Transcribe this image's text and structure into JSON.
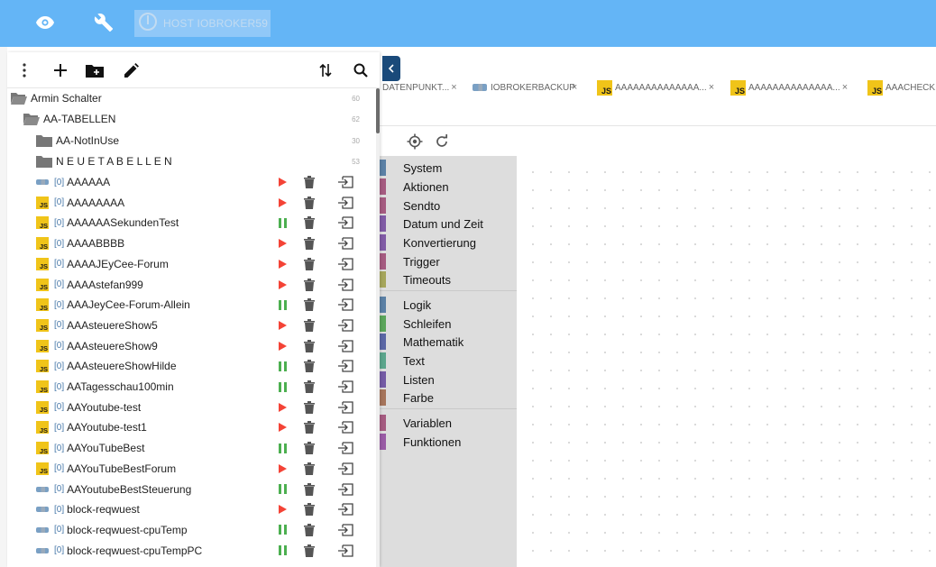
{
  "topbar": {
    "host_label": "HOST IOBROKER59",
    "icons": [
      "eye-icon",
      "wrench-icon",
      "power-icon"
    ]
  },
  "left_panel": {
    "toolbar_icons": [
      "more-vert-icon",
      "add-icon",
      "add-folder-icon",
      "edit-icon",
      "sort-icon",
      "search-icon"
    ],
    "tree": {
      "root": {
        "label": "Armin Schalter",
        "count": "60"
      },
      "folders": [
        {
          "label": "AA-TABELLEN",
          "count": "62"
        },
        {
          "label": "AA-NotInUse",
          "count": "30"
        },
        {
          "label": "N E U E T A B E L L E N",
          "count": "53"
        }
      ],
      "scripts": [
        {
          "index": "[0]",
          "name": "AAAAAA",
          "type": "blockly",
          "state": "stopped"
        },
        {
          "index": "[0]",
          "name": "AAAAAAAA",
          "type": "js",
          "state": "stopped"
        },
        {
          "index": "[0]",
          "name": "AAAAAASekundenTest",
          "type": "js",
          "state": "running"
        },
        {
          "index": "[0]",
          "name": "AAAABBBB",
          "type": "js",
          "state": "stopped"
        },
        {
          "index": "[0]",
          "name": "AAAAJEyCee-Forum",
          "type": "js",
          "state": "stopped"
        },
        {
          "index": "[0]",
          "name": "AAAAstefan999",
          "type": "js",
          "state": "stopped"
        },
        {
          "index": "[0]",
          "name": "AAAJeyCee-Forum-Allein",
          "type": "js",
          "state": "running"
        },
        {
          "index": "[0]",
          "name": "AAAsteuereShow5",
          "type": "js",
          "state": "stopped"
        },
        {
          "index": "[0]",
          "name": "AAAsteuereShow9",
          "type": "js",
          "state": "stopped"
        },
        {
          "index": "[0]",
          "name": "AAAsteuereShowHilde",
          "type": "js",
          "state": "running"
        },
        {
          "index": "[0]",
          "name": "AATagesschau100min",
          "type": "js",
          "state": "running"
        },
        {
          "index": "[0]",
          "name": "AAYoutube-test",
          "type": "js",
          "state": "stopped"
        },
        {
          "index": "[0]",
          "name": "AAYoutube-test1",
          "type": "js",
          "state": "stopped"
        },
        {
          "index": "[0]",
          "name": "AAYouTubeBest",
          "type": "js",
          "state": "running"
        },
        {
          "index": "[0]",
          "name": "AAYouTubeBestForum",
          "type": "js",
          "state": "stopped"
        },
        {
          "index": "[0]",
          "name": "AAYoutubeBestSteuerung",
          "type": "blockly",
          "state": "running"
        },
        {
          "index": "[0]",
          "name": "block-reqwuest",
          "type": "blockly",
          "state": "stopped"
        },
        {
          "index": "[0]",
          "name": "block-reqwuest-cpuTemp",
          "type": "blockly",
          "state": "running"
        },
        {
          "index": "[0]",
          "name": "block-reqwuest-cpuTempPC",
          "type": "blockly",
          "state": "running"
        }
      ]
    }
  },
  "editor": {
    "tabs": [
      {
        "label": "DATENPUNKT...",
        "icon": "none",
        "close": "×"
      },
      {
        "label": "IOBROKERBACKUP",
        "icon": "blockly",
        "close": "×"
      },
      {
        "label": "AAAAAAAAAAAAAA...",
        "icon": "js",
        "close": "×"
      },
      {
        "label": "AAAAAAAAAAAAAA...",
        "icon": "js",
        "close": "×"
      },
      {
        "label": "AAACHECK",
        "icon": "js",
        "close": ""
      }
    ],
    "toolbar_icons": [
      "locate-icon",
      "refresh-icon"
    ],
    "toolbox_groups": [
      [
        {
          "label": "System",
          "color": "#5b80a5"
        },
        {
          "label": "Aktionen",
          "color": "#a55b80"
        },
        {
          "label": "Sendto",
          "color": "#a55b80"
        },
        {
          "label": "Datum und Zeit",
          "color": "#805ba5"
        },
        {
          "label": "Konvertierung",
          "color": "#805ba5"
        },
        {
          "label": "Trigger",
          "color": "#a55b80"
        },
        {
          "label": "Timeouts",
          "color": "#a5a55b"
        }
      ],
      [
        {
          "label": "Logik",
          "color": "#5b80a5"
        },
        {
          "label": "Schleifen",
          "color": "#5ba55b"
        },
        {
          "label": "Mathematik",
          "color": "#5b67a5"
        },
        {
          "label": "Text",
          "color": "#5ba58c"
        },
        {
          "label": "Listen",
          "color": "#745ba5"
        },
        {
          "label": "Farbe",
          "color": "#a5745b"
        }
      ],
      [
        {
          "label": "Variablen",
          "color": "#a55b80"
        },
        {
          "label": "Funktionen",
          "color": "#995ba5"
        }
      ]
    ]
  },
  "colors": {
    "topbar": "#64b5f6",
    "play": "#f44336",
    "pause": "#4caf50",
    "js_badge": "#f0c419"
  }
}
